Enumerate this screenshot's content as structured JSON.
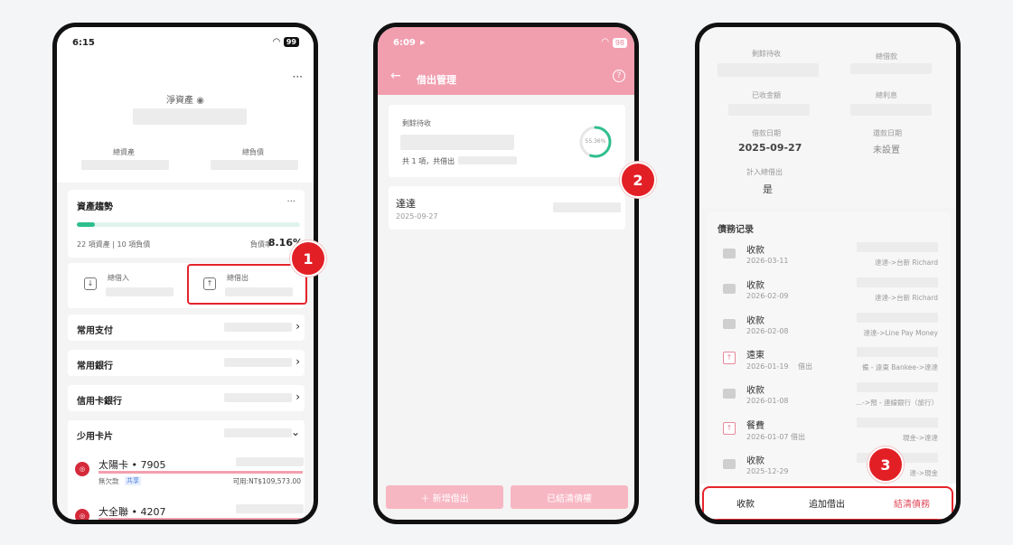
{
  "phone1": {
    "status_time": "6:15",
    "battery": "99",
    "more": "···",
    "net_assets_label": "淨資產",
    "total_assets_label": "總資產",
    "total_liabilities_label": "總負債",
    "trend": {
      "title": "資產趨勢",
      "more": "···",
      "counts": "22 項資產 | 10 項負債",
      "debt_ratio_label": "負債率",
      "debt_ratio_value": "8.16%",
      "progress_fraction": 0.08
    },
    "borrow_in_label": "總借入",
    "lend_out_label": "總借出",
    "rows": [
      {
        "label": "常用支付"
      },
      {
        "label": "常用銀行"
      },
      {
        "label": "信用卡銀行"
      },
      {
        "label": "少用卡片"
      }
    ],
    "cards": [
      {
        "name": "太陽卡 • 7905",
        "sub": "無欠款",
        "tag": "共享",
        "available": "可用:NT$109,573.00"
      },
      {
        "name": "大全聯 • 4207"
      }
    ],
    "badge": "1"
  },
  "phone2": {
    "status_time": "6:09",
    "battery": "98",
    "title": "借出管理",
    "remaining_label": "剩餘待收",
    "summary": "共 1 項，共借出",
    "progress_text": "55.36%",
    "progress_fraction": 0.5536,
    "item_name": "達達",
    "item_date": "2025-09-27",
    "add_button": "＋ 新增借出",
    "settled_button": "已結清債權",
    "badge": "2"
  },
  "phone3": {
    "remaining_label": "剩餘待收",
    "total_lend_label": "總借款",
    "received_label": "已收金額",
    "total_interest_label": "總利息",
    "lend_date_label": "借款日期",
    "lend_date_value": "2025-09-27",
    "repay_date_label": "還款日期",
    "repay_date_value": "未設置",
    "include_label": "計入總借出",
    "include_value": "是",
    "records_title": "債務记录",
    "records": [
      {
        "title": "收款",
        "date": "2026-03-11",
        "route": "達達->台新 Richard",
        "icon": "card"
      },
      {
        "title": "收款",
        "date": "2026-02-09",
        "route": "達達->台新 Richard",
        "icon": "card"
      },
      {
        "title": "收款",
        "date": "2026-02-08",
        "route": "達達->Line Pay Money",
        "icon": "card"
      },
      {
        "title": "遠東",
        "date": "2026-01-19 　借出",
        "route": "備 - 遠東 Bankee->達達",
        "icon": "up"
      },
      {
        "title": "收款",
        "date": "2026-01-08",
        "route": "...->預 - 連線銀行（旅行）",
        "icon": "card"
      },
      {
        "title": "餐費",
        "date": "2026-01-07 借出",
        "route": "現金->達達",
        "icon": "up"
      },
      {
        "title": "收款",
        "date": "2025-12-29",
        "route": "達->現金",
        "icon": "card"
      }
    ],
    "bottom": {
      "receive": "收款",
      "add_lend": "追加借出",
      "settle": "結清債務"
    },
    "badge": "3"
  }
}
